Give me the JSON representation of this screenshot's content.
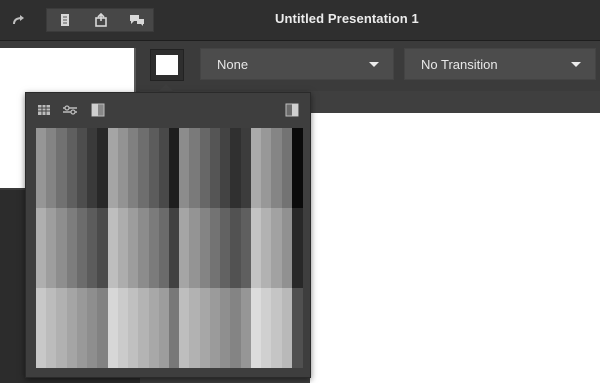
{
  "app": {
    "title": "Untitled Presentation 1"
  },
  "toolbar": {
    "icons": [
      "redo-icon",
      "document-icon",
      "share-icon",
      "comments-icon"
    ]
  },
  "format": {
    "selected_color": "#ffffff",
    "background_dropdown": "None",
    "transition_dropdown": "No Transition"
  },
  "palette": {
    "tabs": [
      "table-icon",
      "adjust-icon",
      "gradient-icon"
    ],
    "side_icon": "image-icon"
  }
}
